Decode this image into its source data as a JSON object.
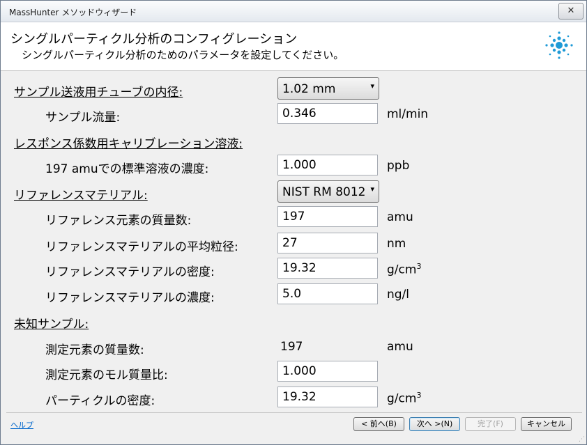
{
  "window": {
    "title": "MassHunter メソッドウィザード",
    "close": "✕"
  },
  "header": {
    "title": "シングルパーティクル分析のコンフィグレーション",
    "subtitle": "シングルパーティクル分析のためのパラメータを設定してください。"
  },
  "form": {
    "tube": {
      "label": "サンプル送液用チューブの内径:",
      "value": "1.02 mm"
    },
    "sample_flow": {
      "label": "サンプル流量:",
      "value": "0.346",
      "unit": "ml/min"
    },
    "response_section": {
      "label": "レスポンス係数用キャリブレーション溶液:"
    },
    "std_conc": {
      "label": "197 amuでの標準溶液の濃度:",
      "value": "1.000",
      "unit": "ppb"
    },
    "ref_material": {
      "label": "リファレンスマテリアル:",
      "value": "NIST RM 8012"
    },
    "ref_mass": {
      "label": "リファレンス元素の質量数:",
      "value": "197",
      "unit": "amu"
    },
    "ref_size": {
      "label": "リファレンスマテリアルの平均粒径:",
      "value": "27",
      "unit": "nm"
    },
    "ref_density": {
      "label": "リファレンスマテリアルの密度:",
      "value": "19.32",
      "unit": "g/cm",
      "unit_sup": "3"
    },
    "ref_conc": {
      "label": "リファレンスマテリアルの濃度:",
      "value": "5.0",
      "unit": "ng/l"
    },
    "unknown_section": {
      "label": "未知サンプル:"
    },
    "meas_mass": {
      "label": "測定元素の質量数:",
      "value": "197",
      "unit": "amu"
    },
    "molar_ratio": {
      "label": "測定元素のモル質量比:",
      "value": "1.000"
    },
    "particle_density": {
      "label": "パーティクルの密度:",
      "value": "19.32",
      "unit": "g/cm",
      "unit_sup": "3"
    }
  },
  "footer": {
    "help": "ヘルプ",
    "back": "< 前へ(B)",
    "next": "次へ >(N)",
    "finish": "完了(F)",
    "cancel": "キャンセル"
  },
  "icons": {
    "dropdown": "▾",
    "resize_grip": "⋰"
  },
  "colors": {
    "accent": "#1f9ad6",
    "link": "#0066cc"
  }
}
